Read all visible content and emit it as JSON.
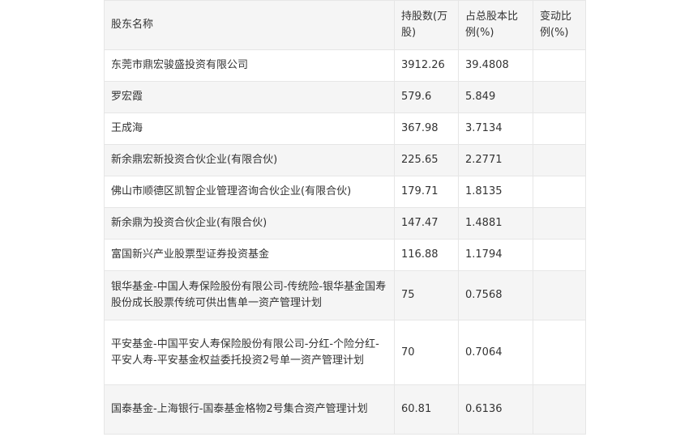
{
  "table": {
    "headers": [
      "股东名称",
      "持股数(万股)",
      "占总股本比例(%)",
      "变动比例(%)"
    ],
    "rows": [
      [
        "东莞市鼎宏骏盛投资有限公司",
        "3912.26",
        "39.4808",
        ""
      ],
      [
        "罗宏霞",
        "579.6",
        "5.849",
        ""
      ],
      [
        "王成海",
        "367.98",
        "3.7134",
        ""
      ],
      [
        "新余鼎宏新投资合伙企业(有限合伙)",
        "225.65",
        "2.2771",
        ""
      ],
      [
        "佛山市顺德区凯智企业管理咨询合伙企业(有限合伙)",
        "179.71",
        "1.8135",
        ""
      ],
      [
        "新余鼎为投资合伙企业(有限合伙)",
        "147.47",
        "1.4881",
        ""
      ],
      [
        "富国新兴产业股票型证券投资基金",
        "116.88",
        "1.1794",
        ""
      ],
      [
        "银华基金-中国人寿保险股份有限公司-传统险-银华基金国寿股份成长股票传统可供出售单一资产管理计划",
        "75",
        "0.7568",
        ""
      ],
      [
        "平安基金-中国平安人寿保险股份有限公司-分红-个险分红-平安人寿-平安基金权益委托投资2号单一资产管理计划",
        "70",
        "0.7064",
        ""
      ],
      [
        "国泰基金-上海银行-国泰基金格物2号集合资产管理计划",
        "60.81",
        "0.6136",
        ""
      ]
    ]
  }
}
